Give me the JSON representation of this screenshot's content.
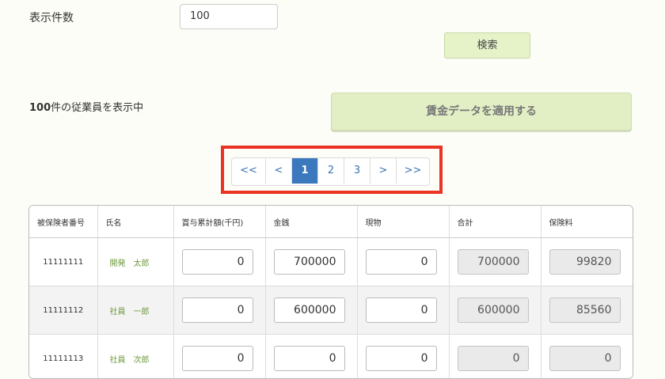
{
  "filter": {
    "count_label": "表示件数",
    "count_value": "100",
    "search_button": "検索"
  },
  "status": {
    "count": "100",
    "suffix": "件の従業員を表示中"
  },
  "apply_button": "賃金データを適用する",
  "pagination": {
    "first": "<<",
    "prev": "<",
    "pages": [
      "1",
      "2",
      "3"
    ],
    "active_page": "1",
    "next": ">",
    "last": ">>"
  },
  "table": {
    "headers": [
      "被保険者番号",
      "氏名",
      "賞与累計額(千円)",
      "金銭",
      "現物",
      "合計",
      "保険料"
    ],
    "rows": [
      {
        "id": "11111111",
        "name": "開発　太郎",
        "bonus": "0",
        "cash": "700000",
        "in_kind": "0",
        "total": "700000",
        "premium": "99820"
      },
      {
        "id": "11111112",
        "name": "社員　一郎",
        "bonus": "0",
        "cash": "600000",
        "in_kind": "0",
        "total": "600000",
        "premium": "85560"
      },
      {
        "id": "11111113",
        "name": "社員　次郎",
        "bonus": "0",
        "cash": "0",
        "in_kind": "0",
        "total": "0",
        "premium": "0"
      }
    ]
  },
  "colors": {
    "background": "#fbfdf6",
    "button_green": "#e2efc4",
    "pagination_active": "#3b78be",
    "highlight_red": "#ea3323",
    "name_green": "#6e9a3a"
  }
}
